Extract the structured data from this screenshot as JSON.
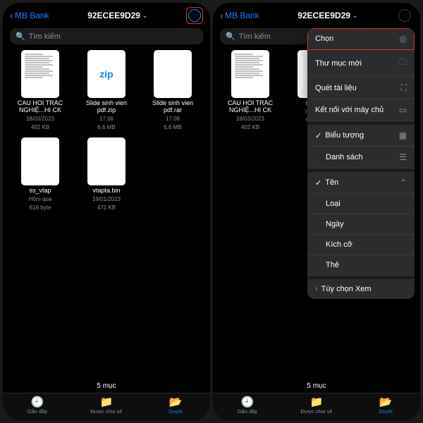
{
  "back_label": "MB Bank",
  "title": "92ECEE9D29",
  "search_placeholder": "Tìm kiếm",
  "files": [
    {
      "name": "CÂU HỎI TRẮC NGHIỆ...HI CK",
      "date": "18/03/2023",
      "size": "402 KB",
      "kind": "doc"
    },
    {
      "name": "Slide sinh vien pdf.zip",
      "date": "17:06",
      "size": "6,6 MB",
      "kind": "zip"
    },
    {
      "name": "Slide sinh vien pdf.rar",
      "date": "17:06",
      "size": "6,6 MB",
      "kind": "blank"
    },
    {
      "name": "ss_vtap",
      "date": "Hôm qua",
      "size": "616 byte",
      "kind": "blank"
    },
    {
      "name": "vtapta.bin",
      "date": "19/01/2023",
      "size": "471 KB",
      "kind": "blank"
    }
  ],
  "footer_count": "5 mục",
  "tabs": [
    {
      "label": "Gần đây",
      "icon": "clock"
    },
    {
      "label": "Được chia sẻ",
      "icon": "folder-person"
    },
    {
      "label": "Duyệt",
      "icon": "folder"
    }
  ],
  "menu": {
    "chon": "Chọn",
    "thu_muc_moi": "Thư mục mới",
    "quet_tai_lieu": "Quét tài liệu",
    "ket_noi": "Kết nối với máy chủ",
    "bieu_tuong": "Biểu tượng",
    "danh_sach": "Danh sách",
    "ten": "Tên",
    "loai": "Loại",
    "ngay": "Ngày",
    "kich_co": "Kích cỡ",
    "the": "Thẻ",
    "tuy_chon_xem": "Tùy chọn Xem"
  }
}
